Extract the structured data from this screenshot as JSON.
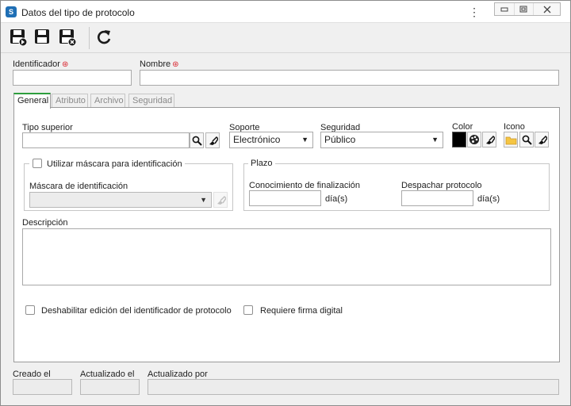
{
  "window": {
    "title": "Datos del tipo de protocolo"
  },
  "fields": {
    "identificador_label": "Identificador",
    "nombre_label": "Nombre",
    "identificador_value": "",
    "nombre_value": ""
  },
  "tabs": [
    {
      "label": "General",
      "active": true
    },
    {
      "label": "Atributo",
      "active": false
    },
    {
      "label": "Archivo",
      "active": false
    },
    {
      "label": "Seguridad",
      "active": false
    }
  ],
  "general": {
    "tipo_superior_label": "Tipo superior",
    "tipo_superior_value": "",
    "soporte_label": "Soporte",
    "soporte_value": "Electrónico",
    "seguridad_label": "Seguridad",
    "seguridad_value": "Público",
    "color_label": "Color",
    "color_value": "#000000",
    "icono_label": "Icono",
    "mascara_group": {
      "checkbox_label": "Utilizar máscara para identificación",
      "mascara_label": "Máscara de identificación",
      "mascara_value": ""
    },
    "plazo_group": {
      "legend": "Plazo",
      "conocimiento_label": "Conocimiento de finalización",
      "conocimiento_value": "",
      "conocimiento_unit": "día(s)",
      "despachar_label": "Despachar protocolo",
      "despachar_value": "",
      "despachar_unit": "día(s)"
    },
    "descripcion_label": "Descripción",
    "descripcion_value": "",
    "deshabilitar_label": "Deshabilitar edición del identificador de protocolo",
    "firma_label": "Requiere firma digital"
  },
  "footer": {
    "creado_label": "Creado el",
    "actualizado_label": "Actualizado el",
    "actualizado_por_label": "Actualizado por"
  },
  "colors": {
    "accent": "#2e9f3e",
    "required": "#d9232d",
    "app_icon": "#1f6fb5"
  }
}
